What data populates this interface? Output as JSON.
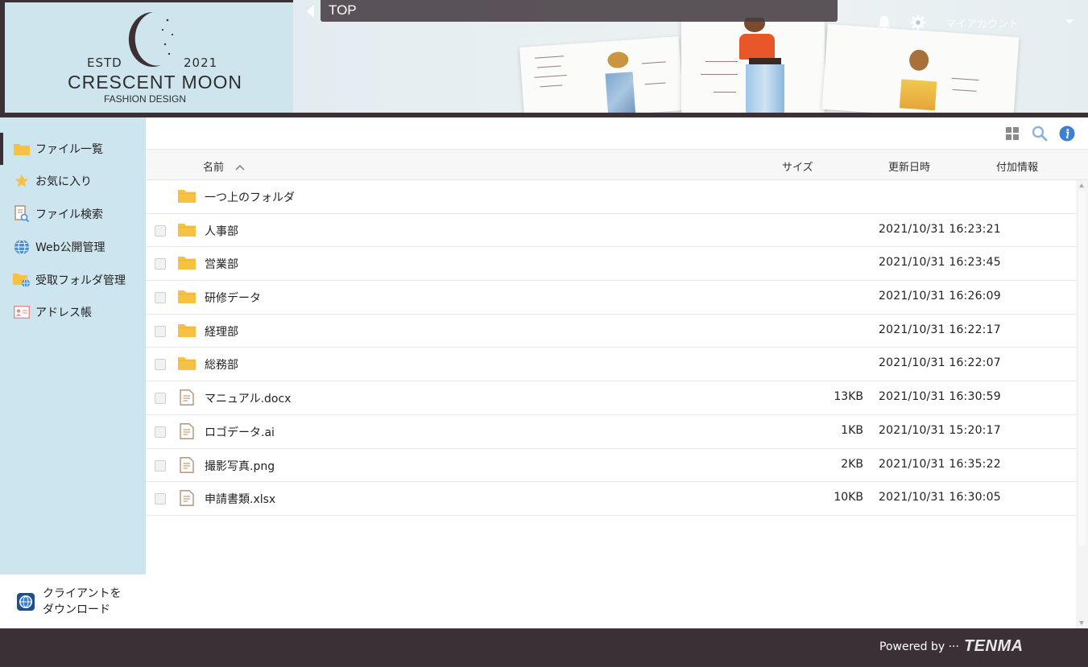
{
  "header": {
    "logo": {
      "estd": "ESTD",
      "year": "2021",
      "name": "CRESCENT MOON",
      "subtitle": "FASHION DESIGN"
    },
    "breadcrumb": "TOP",
    "account_label": "マイアカウント",
    "icons": [
      "bell-icon",
      "gear-icon",
      "chevron-down-icon"
    ]
  },
  "sidebar": {
    "items": [
      {
        "label": "ファイル一覧",
        "icon": "folder-icon",
        "active": true
      },
      {
        "label": "お気に入り",
        "icon": "star-icon",
        "active": false
      },
      {
        "label": "ファイル検索",
        "icon": "file-search-icon",
        "active": false
      },
      {
        "label": "Web公開管理",
        "icon": "globe-icon",
        "active": false
      },
      {
        "label": "受取フォルダ管理",
        "icon": "folder-globe-icon",
        "active": false
      },
      {
        "label": "アドレス帳",
        "icon": "address-card-icon",
        "active": false
      }
    ],
    "download": {
      "line1": "クライアントを",
      "line2": "ダウンロード"
    }
  },
  "toolbar": {
    "icons": [
      "grid-view-icon",
      "search-icon",
      "info-icon"
    ]
  },
  "table": {
    "columns": {
      "name": "名前",
      "size": "サイズ",
      "updated": "更新日時",
      "extra": "付加情報"
    },
    "parent": "一つ上のフォルダ",
    "rows": [
      {
        "type": "folder",
        "name": "人事部",
        "size": "",
        "date": "2021/10/31 16:23:21"
      },
      {
        "type": "folder",
        "name": "営業部",
        "size": "",
        "date": "2021/10/31 16:23:45"
      },
      {
        "type": "folder",
        "name": "研修データ",
        "size": "",
        "date": "2021/10/31 16:26:09"
      },
      {
        "type": "folder",
        "name": "経理部",
        "size": "",
        "date": "2021/10/31 16:22:17"
      },
      {
        "type": "folder",
        "name": "総務部",
        "size": "",
        "date": "2021/10/31 16:22:07"
      },
      {
        "type": "file",
        "name": "マニュアル.docx",
        "size": "13KB",
        "date": "2021/10/31 16:30:59"
      },
      {
        "type": "file",
        "name": "ロゴデータ.ai",
        "size": "1KB",
        "date": "2021/10/31 15:20:17"
      },
      {
        "type": "file",
        "name": "撮影写真.png",
        "size": "2KB",
        "date": "2021/10/31 16:35:22"
      },
      {
        "type": "file",
        "name": "申請書類.xlsx",
        "size": "10KB",
        "date": "2021/10/31 16:30:05"
      }
    ]
  },
  "footer": {
    "powered": "Powered by ···",
    "brand": "TENMA"
  },
  "colors": {
    "dark": "#3a3035",
    "sidebar": "#cde5ef",
    "folder": "#f7c244",
    "accent": "#4a90d9"
  }
}
